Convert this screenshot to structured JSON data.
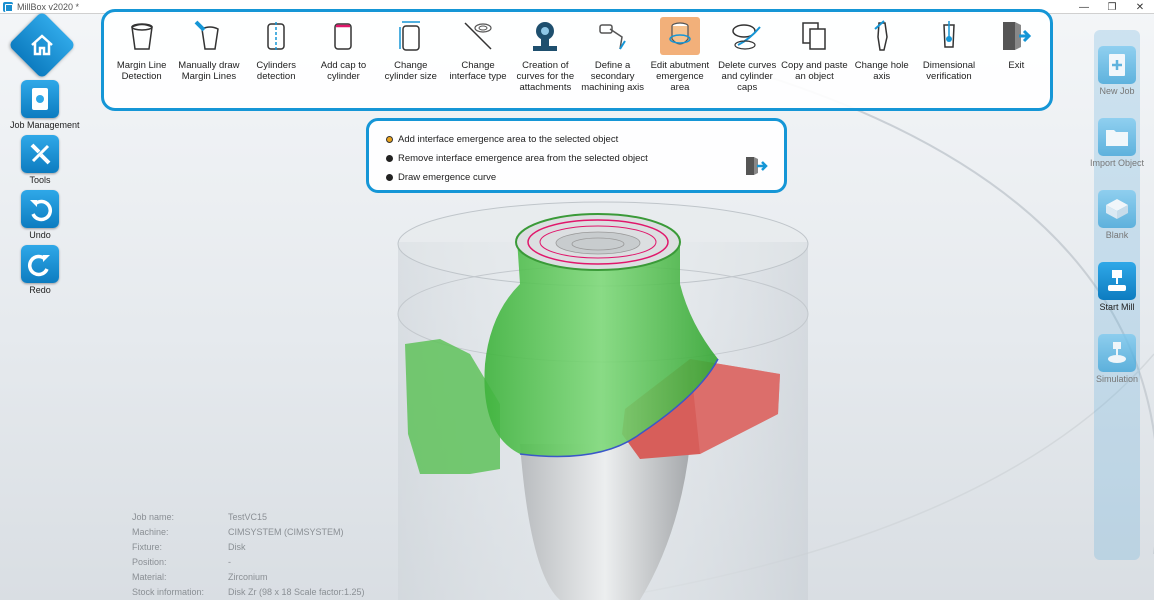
{
  "window": {
    "title": "MillBox v2020 *",
    "minimize": "—",
    "restore": "❐",
    "close": "✕"
  },
  "left_bar": {
    "job_management": "Job Management",
    "tools": "Tools",
    "undo": "Undo",
    "redo": "Redo"
  },
  "toolbar": {
    "items": [
      {
        "label": "Margin Line Detection",
        "icon": "margin-line-icon"
      },
      {
        "label": "Manually draw Margin Lines",
        "icon": "draw-margin-icon"
      },
      {
        "label": "Cylinders detection",
        "icon": "cylinder-detect-icon"
      },
      {
        "label": "Add cap to cylinder",
        "icon": "cap-cylinder-icon"
      },
      {
        "label": "Change cylinder size",
        "icon": "cylinder-size-icon"
      },
      {
        "label": "Change interface type",
        "icon": "interface-type-icon"
      },
      {
        "label": "Creation of curves for the attachments",
        "icon": "attachment-curves-icon"
      },
      {
        "label": "Define a secondary machining axis",
        "icon": "secondary-axis-icon"
      },
      {
        "label": "Edit abutment emergence area",
        "icon": "emergence-area-icon"
      },
      {
        "label": "Delete curves and cylinder caps",
        "icon": "delete-curves-icon"
      },
      {
        "label": "Copy and paste an object",
        "icon": "copy-paste-icon"
      },
      {
        "label": "Change hole axis",
        "icon": "hole-axis-icon"
      },
      {
        "label": "Dimensional verification",
        "icon": "dimension-icon"
      },
      {
        "label": "Exit",
        "icon": "exit-icon"
      }
    ]
  },
  "options": {
    "items": [
      {
        "label": "Add interface emergence area to the selected object",
        "selected": true
      },
      {
        "label": "Remove interface emergence area from the selected object",
        "selected": false
      },
      {
        "label": "Draw emergence curve",
        "selected": false
      }
    ]
  },
  "right_bar": {
    "new_job": "New Job",
    "import_object": "Import Object",
    "blank": "Blank",
    "start_mill": "Start Mill",
    "simulation": "Simulation"
  },
  "job_info": {
    "rows": [
      {
        "key": "Job name:",
        "value": "TestVC15"
      },
      {
        "key": "Machine:",
        "value": "CIMSYSTEM (CIMSYSTEM)"
      },
      {
        "key": "Fixture:",
        "value": "Disk"
      },
      {
        "key": "Position:",
        "value": "-"
      },
      {
        "key": "Material:",
        "value": "Zirconium"
      },
      {
        "key": "Stock information:",
        "value": "Disk Zr (98 x 18 Scale factor:1.25)"
      }
    ]
  },
  "colors": {
    "accent": "#1596d6",
    "model_green": "#4cc24a",
    "model_red": "#d9635f",
    "margin_line": "#e0176b"
  }
}
